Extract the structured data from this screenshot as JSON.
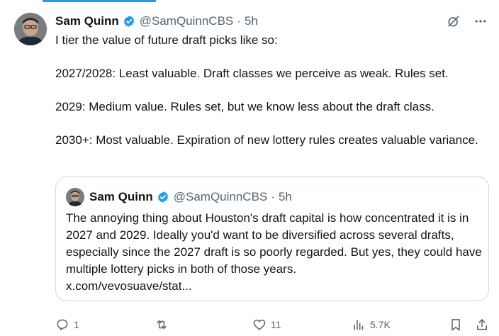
{
  "author": {
    "name": "Sam Quinn",
    "handle": "@SamQuinnCBS",
    "separator": "·",
    "time": "5h"
  },
  "tweet": {
    "paragraphs": [
      "I tier the value of future draft picks like so:",
      "2027/2028: Least valuable. Draft classes we perceive as weak. Rules set.",
      "2029: Medium value. Rules set, but we know less about the draft class.",
      "2030+: Most valuable. Expiration of new lottery rules creates valuable variance."
    ]
  },
  "quote": {
    "name": "Sam Quinn",
    "handle": "@SamQuinnCBS",
    "separator": "·",
    "time": "5h",
    "text": "The annoying thing about Houston's draft capital is how concentrated it is in 2027 and 2029. Ideally you'd want to be diversified across several drafts, especially since the 2027 draft is so poorly regarded. But yes, they could have multiple lottery picks in both of those years.",
    "link": "x.com/vevosuave/stat..."
  },
  "actions": {
    "replies": "1",
    "retweets": "",
    "likes": "11",
    "views": "5.7K"
  },
  "colors": {
    "accent": "#1d9bf0",
    "text": "#0f1419",
    "muted": "#536471",
    "border": "#cfd9de"
  },
  "icons": [
    "grok-slash-icon",
    "more-icon",
    "verified-badge-icon",
    "reply-icon",
    "retweet-icon",
    "like-icon",
    "views-icon",
    "bookmark-icon",
    "share-icon"
  ]
}
